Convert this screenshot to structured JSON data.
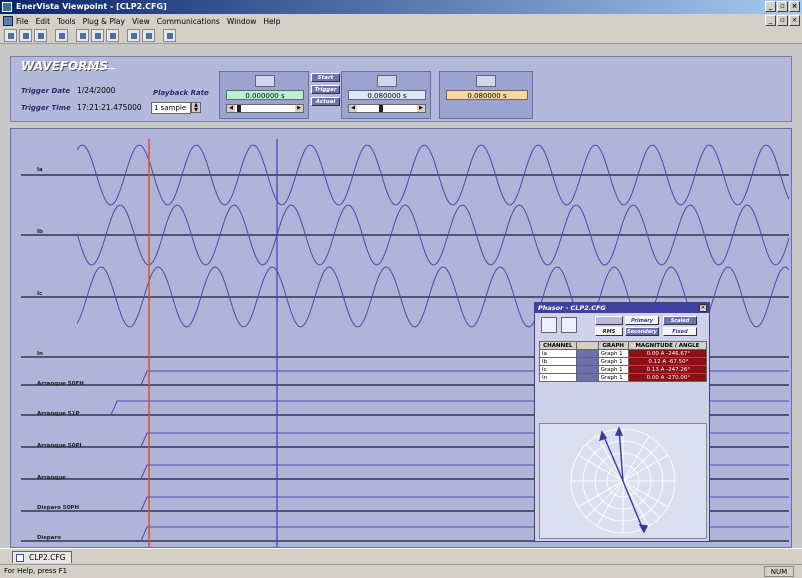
{
  "window": {
    "title": "EnerVista Viewpoint - [CLP2.CFG]",
    "min": "_",
    "max": "▫",
    "close": "×"
  },
  "menu": [
    "File",
    "Edit",
    "Tools",
    "Plug & Play",
    "View",
    "Communications",
    "Window",
    "Help"
  ],
  "panel": {
    "title": "WAVEFORMS",
    "trigger_date_label": "Trigger Date",
    "trigger_date": "1/24/2000",
    "trigger_time_label": "Trigger Time",
    "trigger_time": "17:21:21.475000",
    "playback_label": "Playback Rate",
    "playback_value": "1 sample",
    "cursor1_time": "0.000000 s",
    "cursor2_time": "0.080000 s",
    "delta_time": "0.080000 s",
    "btn_start": "Start",
    "btn_trigger": "Trigger",
    "btn_actual": "Actual"
  },
  "channels": {
    "analog": [
      "Ia",
      "Ib",
      "Ic",
      "In"
    ],
    "digital": [
      "Arranque 50FH",
      "Arranque 51P",
      "Arranque 50PL",
      "Arranque",
      "Disparo 50PH",
      "Disparo"
    ]
  },
  "phasor": {
    "title": "Phasor - CLP2.CFG",
    "btn_rms": "RMS",
    "btn_primary": "Primary",
    "btn_secondary": "Secondary",
    "btn_scaled": "Scaled",
    "btn_fixed": "Fixed",
    "close": "×",
    "headers": [
      "CHANNEL",
      "",
      "GRAPH",
      "MAGNITUDE / ANGLE"
    ],
    "rows": [
      {
        "channel": "Ia",
        "graph": "Graph 1",
        "value": "0.00 A -246.67°"
      },
      {
        "channel": "Ib",
        "graph": "Graph 1",
        "value": "0.12 A -67.50°"
      },
      {
        "channel": "Ic",
        "graph": "Graph 1",
        "value": "0.13 A -247.26°"
      },
      {
        "channel": "In",
        "graph": "Graph 1",
        "value": "0.00 A -270.00°"
      }
    ]
  },
  "tab": {
    "label": "CLP2.CFG"
  },
  "status": {
    "help": "For Help, press F1",
    "num": "NUM"
  }
}
